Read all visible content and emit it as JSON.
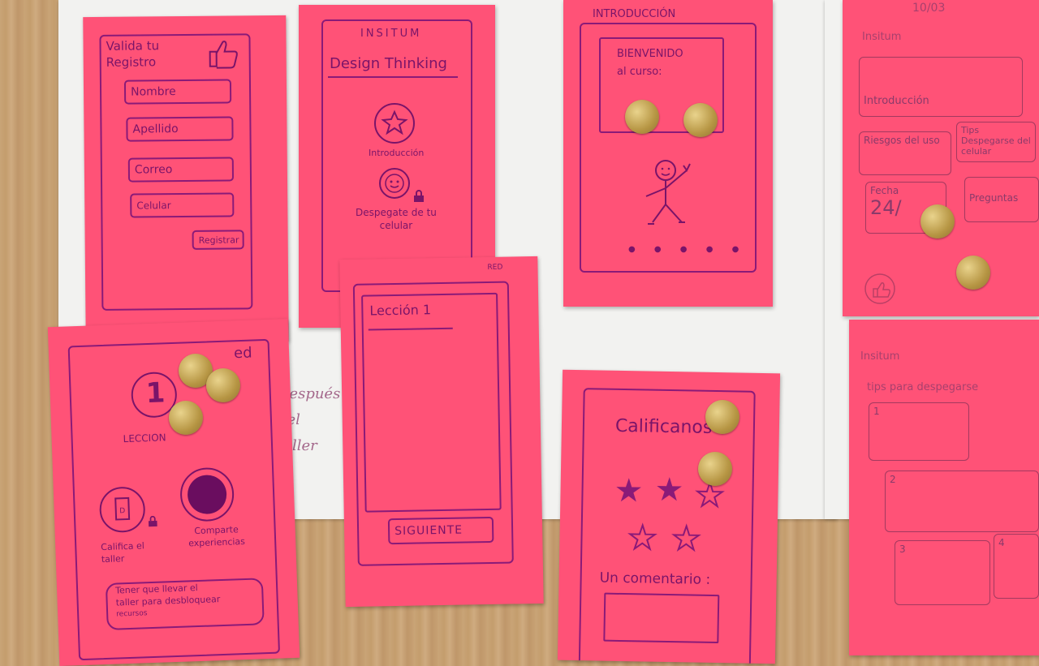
{
  "notes": {
    "registro": {
      "title_line1": "Valida tu",
      "title_line2": "Registro",
      "fields": [
        "Nombre",
        "Apellido",
        "Correo",
        "Celular"
      ],
      "button": "Registrar",
      "icon": "thumbs-up-icon"
    },
    "home": {
      "brand": "INSITUM",
      "title": "Design Thinking",
      "item1_label": "Introducción",
      "item1_icon": "star-icon",
      "item2_label_line1": "Despegate de tu",
      "item2_label_line2": "celular",
      "item2_icon": "smiley-icon",
      "lock_icon": "lock-icon"
    },
    "intro": {
      "header": "INTRODUCCIÓN",
      "welcome_line1": "BIENVENIDO",
      "welcome_line2": "al curso:",
      "figure_icon": "stick-figure-icon",
      "pager": "● ● ● ● ●"
    },
    "badges": {
      "corner": "ed",
      "number": "1",
      "label": "LECCION",
      "item1_label_line1": "Califica el",
      "item1_label_line2": "taller",
      "item2_label_line1": "Comparte",
      "item2_label_line2": "experiencias",
      "footer_line1": "Tener que llevar el",
      "footer_line2": "taller para desbloquear",
      "footer_line3": "recursos"
    },
    "leccion": {
      "title": "Lección 1",
      "corner": "RED",
      "button": "SIGUIENTE"
    },
    "rating": {
      "title": "Calificanos",
      "comment_label": "Un comentario :",
      "stars_filled": 2,
      "stars_total": 5
    },
    "dash": {
      "date": "10/03",
      "brand": "Insitum",
      "banner": "Introducción",
      "cell1": "Riesgos del uso",
      "cell2": "Tips Despegarse del celular",
      "cell3_label": "Fecha",
      "cell3_value": "24/",
      "cell4": "Preguntas"
    },
    "tips": {
      "brand": "Insitum",
      "subtitle": "tips para despegarse",
      "items": [
        "1",
        "2",
        "3",
        "4"
      ]
    }
  },
  "paper_note": {
    "line1": "Después",
    "line2": "del",
    "line3": "taller"
  },
  "colors": {
    "note": "#ff5277",
    "ink": "#7a1469",
    "sticker": "#c8a94e",
    "wood": "#c9a477"
  }
}
